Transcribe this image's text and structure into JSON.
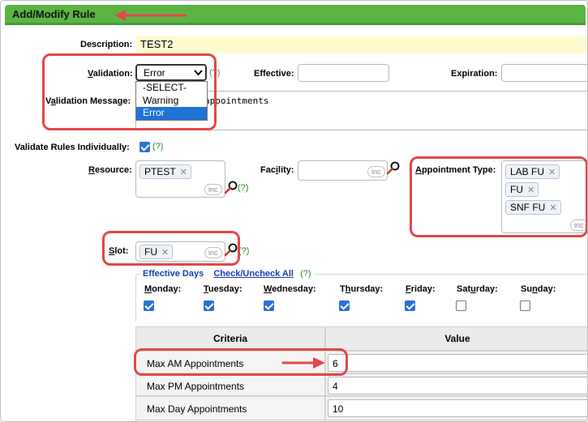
{
  "title": "Add/Modify Rule",
  "form": {
    "description_label": "Description:",
    "description_value": "TEST2",
    "validation_label": "Validation:",
    "validation_value": "Error",
    "validation_help": "(?)",
    "validation_options": [
      "-SELECT-",
      "Warning",
      "Error"
    ],
    "effective_label": "Effective:",
    "expiration_label": "Expiration:",
    "validation_message_label": "Validation Message:",
    "validation_message_value": "appointments",
    "validate_individually_label": "Validate Rules Individually:",
    "validate_individually_help": "(?)",
    "resource_label": "Resource:",
    "resource_chips": [
      "PTEST"
    ],
    "resource_help": "(?)",
    "facility_label": "Facility:",
    "appointment_type_label": "Appointment Type:",
    "appointment_type_chips": [
      "LAB FU",
      "FU",
      "SNF FU"
    ],
    "slot_label": "Slot:",
    "slot_chips": [
      "FU"
    ],
    "slot_help": "(?)",
    "inc_label": "inc"
  },
  "effective_days": {
    "title": "Effective Days",
    "toggle_link": "Check/Uncheck All",
    "help": "(?)",
    "days": [
      {
        "label": "Monday:",
        "checked": true
      },
      {
        "label": "Tuesday:",
        "checked": true
      },
      {
        "label": "Wednesday:",
        "checked": true
      },
      {
        "label": "Thursday:",
        "checked": true
      },
      {
        "label": "Friday:",
        "checked": true
      },
      {
        "label": "Saturday:",
        "checked": false
      },
      {
        "label": "Sunday:",
        "checked": false
      }
    ]
  },
  "criteria_table": {
    "headers": [
      "Criteria",
      "Value"
    ],
    "rows": [
      {
        "criteria": "Max AM Appointments",
        "value": "6"
      },
      {
        "criteria": "Max PM Appointments",
        "value": "4"
      },
      {
        "criteria": "Max Day Appointments",
        "value": "10"
      }
    ]
  },
  "colors": {
    "title_bar": "#5bb543",
    "highlight": "#e2474b",
    "checkbox": "#2a71d1",
    "link": "#1a3fb0",
    "help": "#2e8b2e"
  }
}
